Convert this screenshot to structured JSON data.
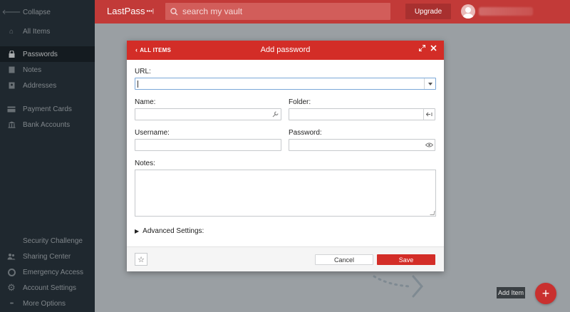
{
  "sidebar": {
    "items": [
      {
        "label": "Collapse",
        "icon": "arrow-left-icon",
        "glyph": "🡐"
      },
      {
        "label": "All Items",
        "icon": "home-icon",
        "glyph": "⌂"
      },
      {
        "label": "Passwords",
        "icon": "lock-icon",
        "glyph": "🔒",
        "active": true
      },
      {
        "label": "Notes",
        "icon": "note-icon",
        "glyph": "▤"
      },
      {
        "label": "Addresses",
        "icon": "address-card-icon",
        "glyph": "▣"
      },
      {
        "label": "Payment Cards",
        "icon": "credit-card-icon",
        "glyph": "▭"
      },
      {
        "label": "Bank Accounts",
        "icon": "bank-icon",
        "glyph": "⌂"
      }
    ],
    "bottom_items": [
      {
        "label": "Security Challenge",
        "icon": "shield-icon",
        "glyph": ""
      },
      {
        "label": "Sharing Center",
        "icon": "people-icon",
        "glyph": "👥"
      },
      {
        "label": "Emergency Access",
        "icon": "life-ring-icon",
        "glyph": "◎"
      },
      {
        "label": "Account Settings",
        "icon": "gear-icon",
        "glyph": "⚙"
      },
      {
        "label": "More Options",
        "icon": "ellipsis-icon",
        "glyph": "•••"
      }
    ]
  },
  "topbar": {
    "brand": "LastPass",
    "brand_dots": "•••|",
    "search_placeholder": "search my vault",
    "upgrade_label": "Upgrade"
  },
  "modal": {
    "back_label": "ALL ITEMS",
    "title": "Add password",
    "url_label": "URL:",
    "url_value": "",
    "name_label": "Name:",
    "name_value": "",
    "folder_label": "Folder:",
    "folder_value": "",
    "username_label": "Username:",
    "username_value": "",
    "password_label": "Password:",
    "password_value": "",
    "notes_label": "Notes:",
    "notes_value": "",
    "advanced_label": "Advanced Settings:",
    "cancel_label": "Cancel",
    "save_label": "Save"
  },
  "fab": {
    "tooltip": "Add Item",
    "glyph": "+"
  },
  "colors": {
    "brand_red": "#d32d27",
    "topbar_red": "#c23a38",
    "sidebar_bg": "#2a363f"
  }
}
